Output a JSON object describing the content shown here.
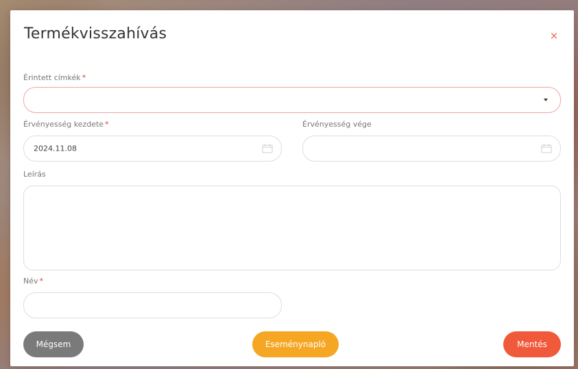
{
  "modal": {
    "title": "Termékvisszahívás",
    "close_symbol": "×"
  },
  "fields": {
    "labels": {
      "label": "Érintett címkék",
      "required": "*"
    },
    "valid_from": {
      "label": "Érvényesség kezdete",
      "required": "*",
      "value": "2024.11.08"
    },
    "valid_to": {
      "label": "Érvényesség vége",
      "value": ""
    },
    "description": {
      "label": "Leírás",
      "value": ""
    },
    "name": {
      "label": "Név",
      "required": "*",
      "value": ""
    }
  },
  "buttons": {
    "cancel": "Mégsem",
    "event_log": "Eseménynapló",
    "save": "Mentés"
  },
  "colors": {
    "accent_close": "#f0624a",
    "cancel": "#7a7a7a",
    "event_log": "#f5a623",
    "save": "#f0593a",
    "required": "#e53935"
  },
  "icons": {
    "close": "close-icon",
    "dropdown": "chevron-down-icon",
    "calendar": "calendar-icon"
  }
}
